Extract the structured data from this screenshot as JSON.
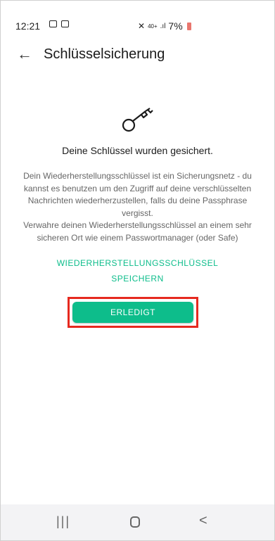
{
  "status_bar": {
    "time": "12:21",
    "network": "40+",
    "battery_text": "7%"
  },
  "app_bar": {
    "title": "Schlüsselsicherung"
  },
  "content": {
    "headline": "Deine Schlüssel wurden gesichert.",
    "body_line1": "Dein Wiederherstellungsschlüssel ist ein Sicherungsnetz - du kannst es benutzen um den Zugriff auf deine verschlüsselten Nachrichten wiederherzustellen, falls du deine Passphrase vergisst.",
    "body_line2": "Verwahre deinen Wiederherstellungsschlüssel an einem sehr sicheren Ort wie einem Passwortmanager (oder Safe)",
    "save_link": "WIEDERHERSTELLUNGSSCHLÜSSEL SPEICHERN",
    "done_button": "ERLEDIGT"
  },
  "nav_bar": {
    "recent_glyph": "|||",
    "back_glyph": "<"
  },
  "colors": {
    "accent": "#0dbd8b",
    "highlight": "#e6291f"
  }
}
